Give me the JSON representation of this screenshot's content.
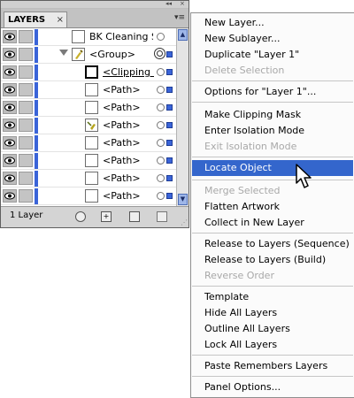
{
  "panel": {
    "tab_label": "LAYERS",
    "tab_close": "×",
    "collapse_glyph": "◂◂",
    "close_glyph": "×",
    "menu_glyph": "▾≡",
    "status_text": "1 Layer",
    "accent_color": "#3a64d8",
    "rows": [
      {
        "label": "BK Cleaning S..."
      },
      {
        "label": "<Group>"
      },
      {
        "label": "<Clipping ..."
      },
      {
        "label": "<Path>"
      },
      {
        "label": "<Path>"
      },
      {
        "label": "<Path>"
      },
      {
        "label": "<Path>"
      },
      {
        "label": "<Path>"
      },
      {
        "label": "<Path>"
      },
      {
        "label": "<Path>"
      }
    ],
    "bottom_icons": [
      "make-clipping-mask-icon",
      "new-sublayer-icon",
      "new-layer-icon",
      "trash-icon"
    ]
  },
  "menu": {
    "highlight_color": "#3466cc",
    "items": [
      {
        "label": "New Layer..."
      },
      {
        "label": "New Sublayer..."
      },
      {
        "label": "Duplicate \"Layer 1\""
      },
      {
        "label": "Delete Selection"
      },
      {
        "label": "Options for \"Layer 1\"..."
      },
      {
        "label": "Make Clipping Mask"
      },
      {
        "label": "Enter Isolation Mode"
      },
      {
        "label": "Exit Isolation Mode"
      },
      {
        "label": "Locate Object"
      },
      {
        "label": "Merge Selected"
      },
      {
        "label": "Flatten Artwork"
      },
      {
        "label": "Collect in New Layer"
      },
      {
        "label": "Release to Layers (Sequence)"
      },
      {
        "label": "Release to Layers (Build)"
      },
      {
        "label": "Reverse Order"
      },
      {
        "label": "Template"
      },
      {
        "label": "Hide All Layers"
      },
      {
        "label": "Outline All Layers"
      },
      {
        "label": "Lock All Layers"
      },
      {
        "label": "Paste Remembers Layers"
      },
      {
        "label": "Panel Options..."
      }
    ]
  }
}
